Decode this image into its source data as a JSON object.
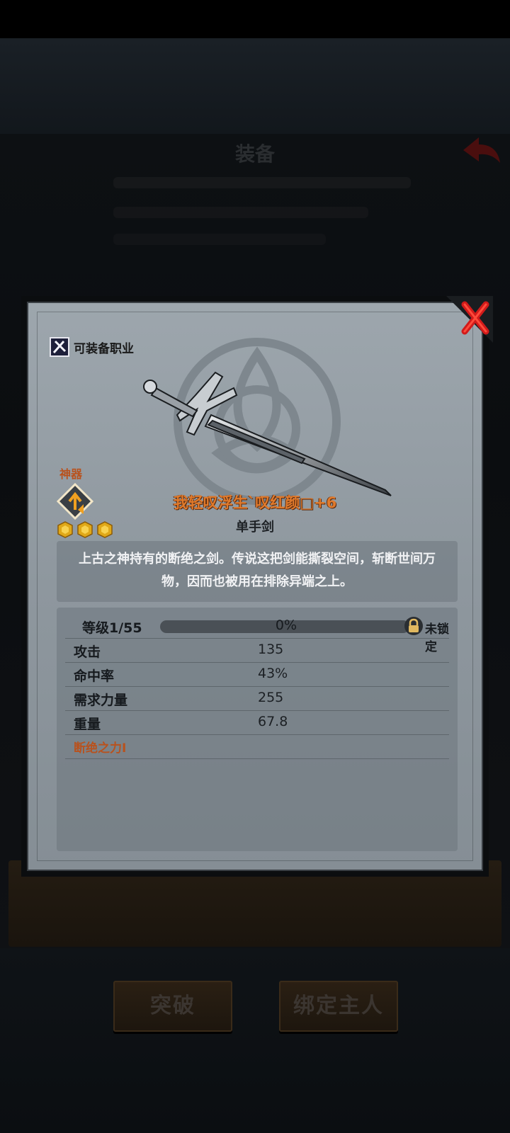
{
  "background": {
    "title": "装备",
    "buttons": {
      "breakthrough": "突破",
      "bind_owner": "绑定主人"
    }
  },
  "dialog": {
    "class_label": "可装备职业",
    "rarity_label": "神器",
    "stars": 3,
    "item_name": "我轻叹浮生`叹红颜□+6",
    "item_type": "单手剑",
    "description": "上古之神持有的断绝之剑。传说这把剑能撕裂空间，斩断世间万物，因而也被用在排除异端之上。",
    "level": {
      "label": "等级1/55",
      "progress_text": "0%",
      "progress": 0.0,
      "lock_label": "未锁定"
    },
    "stats": [
      {
        "name": "攻击",
        "value": "135"
      },
      {
        "name": "命中率",
        "value": "43%"
      },
      {
        "name": "需求力量",
        "value": "255"
      },
      {
        "name": "重量",
        "value": "67.8"
      }
    ],
    "special_skill": "断绝之力I"
  },
  "colors": {
    "accent_orange": "#e07a2c",
    "rarity_orange": "#b8521e",
    "close_red": "#d11a1a"
  }
}
